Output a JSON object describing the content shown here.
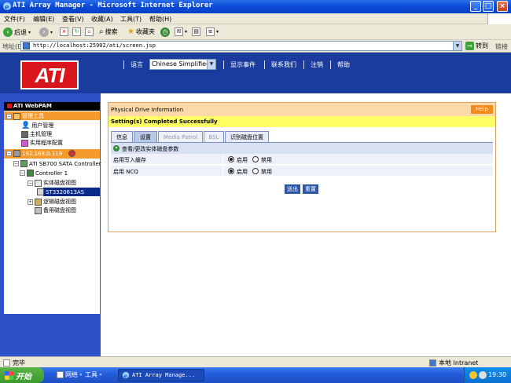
{
  "window": {
    "title": "ATI Array Manager - Microsoft Internet Explorer"
  },
  "menu": [
    "文件(F)",
    "编辑(E)",
    "查看(V)",
    "收藏(A)",
    "工具(T)",
    "帮助(H)"
  ],
  "toolbar": {
    "back": "后退",
    "search": "搜索",
    "favorites": "收藏夹"
  },
  "address": {
    "label": "地址(D)",
    "url": "http://localhost:25902/ati/screen.jsp",
    "go": "转到",
    "links": "链接"
  },
  "header": {
    "logo": "ATI",
    "lang_label": "语言",
    "lang_value": "Chinese Simplified",
    "nav": [
      "显示事件",
      "联系我们",
      "注销",
      "帮助"
    ]
  },
  "tree": {
    "root": "ATI WebPAM",
    "admin_tools": "管理工具",
    "user_mgmt": "用户管理",
    "host_mgmt": "主机管理",
    "utility_config": "实用程序配置",
    "host_ip": "192.168.0.119",
    "controller_sata": "ATI SB700 SATA Controller",
    "controller_1": "Controller 1",
    "physical_view": "实体磁盘视图",
    "drive": "ST3320613AS",
    "logical_view": "逻辑磁盘视图",
    "spare_view": "备用磁盘视图"
  },
  "panel": {
    "title": "Physical Drive Information",
    "help": "Help",
    "status": "Setting(s) Completed Successfully",
    "tabs": [
      "信息",
      "设置",
      "Media Patrol",
      "BSL",
      "识别磁盘位置"
    ],
    "section": "查看/更改实体磁盘参数",
    "rows": [
      {
        "label": "启用写入缓存",
        "on": "启用",
        "off": "禁用",
        "selected": "on"
      },
      {
        "label": "启用 NCQ",
        "on": "启用",
        "off": "禁用",
        "selected": "on"
      }
    ],
    "submit": "送出",
    "reset": "重置"
  },
  "statusbar": {
    "left": "完毕",
    "zone": "本地 Intranet"
  },
  "taskbar": {
    "start": "开始",
    "network": "网络",
    "tools": "工具",
    "task": "ATI Array Manage...",
    "clock": "19:30"
  }
}
